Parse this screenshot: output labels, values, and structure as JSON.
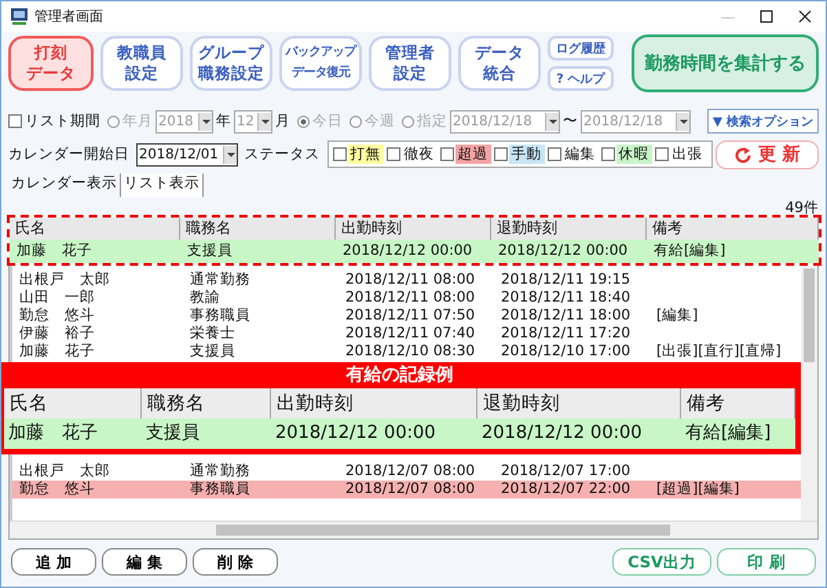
{
  "window": {
    "title": "管理者画面"
  },
  "toolbar": {
    "buttons": [
      {
        "lines": [
          "打刻",
          "データ"
        ],
        "kind": "active"
      },
      {
        "lines": [
          "教職員",
          "設定"
        ],
        "kind": "nav"
      },
      {
        "lines": [
          "グループ",
          "職務設定"
        ],
        "kind": "nav"
      },
      {
        "lines": [
          "バックアップ",
          "データ復元"
        ],
        "kind": "nav"
      },
      {
        "lines": [
          "管理者",
          "設定"
        ],
        "kind": "nav"
      },
      {
        "lines": [
          "データ",
          "統合"
        ],
        "kind": "nav"
      },
      {
        "label": "ログ履歴",
        "kind": "small"
      },
      {
        "label": "? ヘルプ",
        "kind": "small"
      },
      {
        "label": "勤務時間を集計する",
        "kind": "primary"
      }
    ]
  },
  "filters": {
    "list_period": {
      "label": "リスト期間",
      "checked": false
    },
    "month_radio": {
      "label": "年月",
      "selected": false
    },
    "year": "2018",
    "year_unit": "年",
    "month": "12",
    "month_unit": "月",
    "radios": [
      {
        "label": "今日",
        "selected": true
      },
      {
        "label": "今週",
        "selected": false
      },
      {
        "label": "指定",
        "selected": false
      }
    ],
    "date_from": "2018/12/18",
    "range_sep": "〜",
    "date_to": "2018/12/18",
    "search_options": "▼ 検索オプション",
    "calendar_start_label": "カレンダー開始日",
    "calendar_start": "2018/12/01",
    "status_label": "ステータス",
    "statuses": [
      {
        "label": "打無",
        "checked": false,
        "color": "#ffffa0"
      },
      {
        "label": "徹夜",
        "checked": false
      },
      {
        "label": "超過",
        "checked": false,
        "color": "#f4a4a4"
      },
      {
        "label": "手動",
        "checked": false,
        "color": "#c6e6f6"
      },
      {
        "label": "編集",
        "checked": false
      },
      {
        "label": "休暇",
        "checked": false,
        "color": "#c8f4c8"
      },
      {
        "label": "出張",
        "checked": false
      }
    ],
    "refresh": "更 新"
  },
  "tabs": [
    {
      "label": "カレンダー表示",
      "selected": false
    },
    {
      "label": "リスト表示",
      "selected": true
    }
  ],
  "list": {
    "count": "49件",
    "columns": [
      "氏名",
      "職務名",
      "出勤時刻",
      "退勤時刻",
      "備考"
    ],
    "example_row": {
      "cells": [
        "加藤　花子",
        "支援員",
        "2018/12/12 00:00",
        "2018/12/12 00:00",
        "有給[編集]"
      ],
      "color": "#c8f6c6"
    },
    "rows_top": [
      {
        "cells": [
          "出根戸　太郎",
          "通常勤務",
          "2018/12/11 08:00",
          "2018/12/11 19:15",
          ""
        ]
      },
      {
        "cells": [
          "山田　一郎",
          "教諭",
          "2018/12/11 08:00",
          "2018/12/11 18:40",
          ""
        ]
      },
      {
        "cells": [
          "勤怠　悠斗",
          "事務職員",
          "2018/12/11 07:50",
          "2018/12/11 18:00",
          "[編集]"
        ]
      },
      {
        "cells": [
          "伊藤　裕子",
          "栄養士",
          "2018/12/11 07:40",
          "2018/12/11 17:20",
          ""
        ]
      },
      {
        "cells": [
          "加藤　花子",
          "支援員",
          "2018/12/10 08:30",
          "2018/12/10 17:00",
          "[出張][直行][直帰]"
        ]
      }
    ],
    "callout": {
      "title": "有給の記録例",
      "columns": [
        "氏名",
        "職務名",
        "出勤時刻",
        "退勤時刻",
        "備考"
      ],
      "row": {
        "cells": [
          "加藤　花子",
          "支援員",
          "2018/12/12 00:00",
          "2018/12/12 00:00",
          "有給[編集]"
        ],
        "color": "#c8f6c6"
      }
    },
    "rows_bottom": [
      {
        "cells": [
          "出根戸　太郎",
          "通常勤務",
          "2018/12/07 08:00",
          "2018/12/07 17:00",
          ""
        ]
      },
      {
        "cells": [
          "勤怠　悠斗",
          "事務職員",
          "2018/12/07 08:00",
          "2018/12/07 22:00",
          "[超過][編集]"
        ],
        "color": "#f6b0b0"
      }
    ]
  },
  "bottom_buttons": [
    {
      "label": "追 加",
      "kind": "plain"
    },
    {
      "label": "編 集",
      "kind": "plain"
    },
    {
      "label": "削 除",
      "kind": "plain"
    },
    {
      "label": "CSV出力",
      "kind": "green"
    },
    {
      "label": "印 刷",
      "kind": "green"
    }
  ]
}
